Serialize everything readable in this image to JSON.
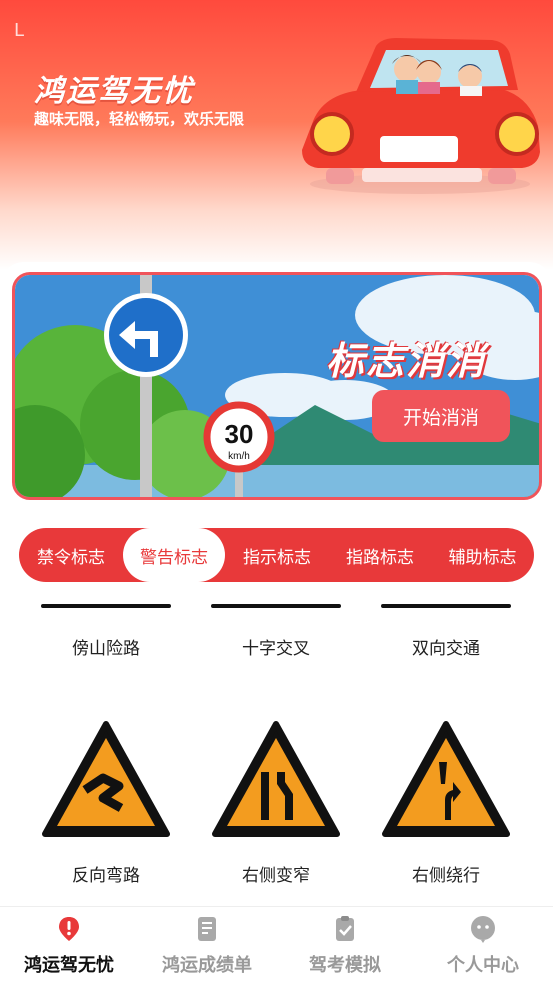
{
  "header": {
    "status_glyph": "L",
    "title": "鸿运驾无忧",
    "subtitle": "趣味无限，轻松畅玩，欢乐无限"
  },
  "banner": {
    "title": "标志消消",
    "start_button": "开始消消",
    "speed_sign_value": "30",
    "speed_sign_unit": "km/h"
  },
  "tabs": [
    {
      "label": "禁令标志",
      "active": false
    },
    {
      "label": "警告标志",
      "active": true
    },
    {
      "label": "指示标志",
      "active": false
    },
    {
      "label": "指路标志",
      "active": false
    },
    {
      "label": "辅助标志",
      "active": false
    }
  ],
  "signs_row1": [
    {
      "label": "傍山险路"
    },
    {
      "label": "十字交叉"
    },
    {
      "label": "双向交通"
    }
  ],
  "signs_row2": [
    {
      "label": "反向弯路",
      "icon": "reverse-curve-sign-icon"
    },
    {
      "label": "右侧变窄",
      "icon": "right-narrow-sign-icon"
    },
    {
      "label": "右侧绕行",
      "icon": "right-detour-sign-icon"
    }
  ],
  "colors": {
    "accent": "#e8393a",
    "sign_fill": "#f39c1f"
  },
  "bottom_nav": [
    {
      "label": "鸿运驾无忧",
      "icon": "alert-pin-icon",
      "active": true
    },
    {
      "label": "鸿运成绩单",
      "icon": "score-report-icon",
      "active": false
    },
    {
      "label": "驾考模拟",
      "icon": "exam-checklist-icon",
      "active": false
    },
    {
      "label": "个人中心",
      "icon": "profile-face-icon",
      "active": false
    }
  ]
}
